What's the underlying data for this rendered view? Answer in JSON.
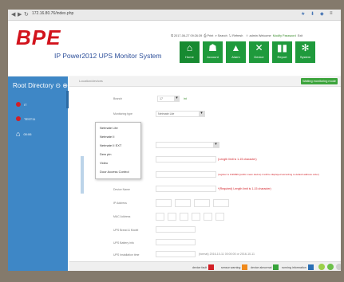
{
  "browser": {
    "url": "172.16.80.76/index.php",
    "nav_icons": [
      "back-icon",
      "forward-icon",
      "reload-icon"
    ],
    "toolbar_icons": [
      "star-icon",
      "download-icon",
      "shield-icon",
      "menu-icon"
    ]
  },
  "header": {
    "logo": "BPE",
    "subtitle": "IP Power2012 UPS Monitor System",
    "top_links": {
      "datetime": "2017-06-27 09:26:39",
      "print": "Print",
      "search": "Search",
      "refresh": "Refresh",
      "user": "admin Welcome",
      "modify_password": "Modify Password",
      "exit": "Exit"
    },
    "tiles": [
      {
        "label": "Home",
        "icon": "home-icon"
      },
      {
        "label": "Account",
        "icon": "users-icon"
      },
      {
        "label": "Alarm",
        "icon": "warning-icon"
      },
      {
        "label": "Device",
        "icon": "tools-icon"
      },
      {
        "label": "Report",
        "icon": "bar-chart-icon"
      },
      {
        "label": "System",
        "icon": "gear-icon"
      }
    ]
  },
  "sidebar": {
    "title": "Root Directory",
    "items": [
      {
        "label": "IT"
      },
      {
        "label": "TEST11"
      },
      {
        "label": "00:06"
      }
    ]
  },
  "main": {
    "tab": "Location/devices",
    "status_badge": "Waiting monitoring mode",
    "fields": {
      "branch_label": "Branch",
      "branch_value": "17",
      "branch_unit": "int",
      "monitoring_type_label": "Monitoring type",
      "monitoring_type_value": "Netmate Lite",
      "name_info_label": "Name info",
      "device_type_label": "Device type",
      "device_ip_label": "Device IP",
      "device_ip_hint": "(Length limit is 1-15 character)",
      "linkage_label": "Linkage key",
      "linkage_hint": "(register is 0-99999 (public mean device) it will be displayed according to default address order)",
      "device_name_label": "Device Name",
      "device_name_hint": "*(Required) Length limit is 1-15 character)",
      "ip_address_label": "IP Address",
      "mac_label": "MAC Address",
      "ups_brand_label": "UPS Brand & Model",
      "ups_battery_label": "UPS Battery info",
      "ups_install_label": "UPS Installation time",
      "ups_install_hint": "(format) 2016-10-11 00:00:00 or 2016-10-11"
    },
    "dropdown_options": [
      "Netmate Lite",
      "Netmate II",
      "Netmate II EXT",
      "Dew pin",
      "Video",
      "Door Access Control"
    ]
  },
  "footer": {
    "legend": [
      {
        "label": "device fault",
        "color": "#d21f26"
      },
      {
        "label": "sensor warning",
        "color": "#f08a1c"
      },
      {
        "label": "device abnormal",
        "color": "#37a33a"
      },
      {
        "label": "running information",
        "color": "#2a6fb5"
      }
    ]
  },
  "colors": {
    "frame": "#847a6c",
    "sidebar": "#3e87c6",
    "tile_green": "#1f9a3c",
    "brand_red": "#d2131c",
    "subtitle_blue": "#2d4f9a"
  }
}
